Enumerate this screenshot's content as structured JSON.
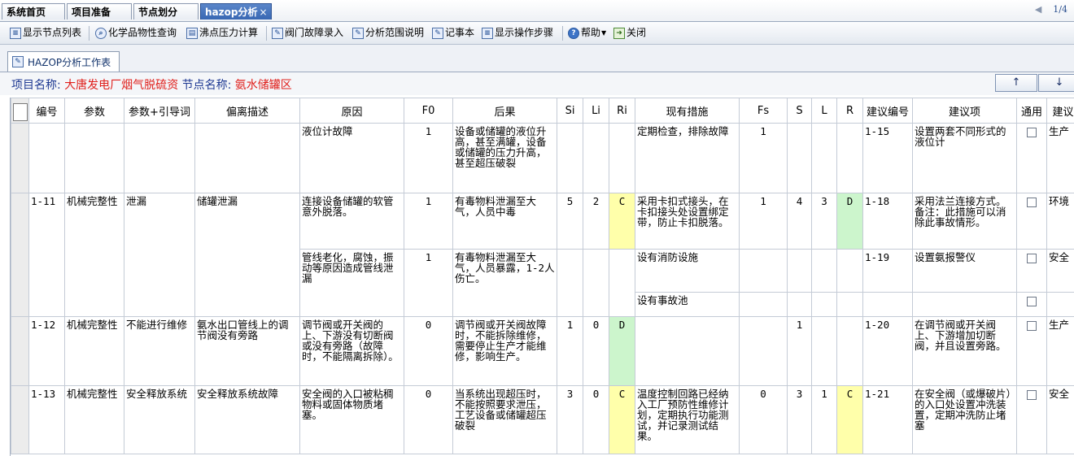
{
  "tabs": [
    {
      "label": "系统首页"
    },
    {
      "label": "项目准备"
    },
    {
      "label": "节点划分"
    },
    {
      "label": "hazop分析"
    }
  ],
  "tab_close": "×",
  "pager": {
    "arrow": "◀",
    "text": "1/4"
  },
  "toolbar": {
    "show_nodes": "显示节点列表",
    "chem_query": "化学品物性查询",
    "boil_calc": "沸点压力计算",
    "valve_fault": "阀门故障录入",
    "scope_note": "分析范围说明",
    "notepad": "记事本",
    "show_steps": "显示操作步骤",
    "help": "帮助",
    "close": "关闭"
  },
  "panel": {
    "tab_label": "HAZOP分析工作表"
  },
  "info": {
    "project_label": "项目名称:",
    "project_value": "大唐发电厂烟气脱硫资",
    "node_label": "节点名称:",
    "node_value": "氨水储罐区",
    "up": "↑",
    "down": "↓"
  },
  "colors": {
    "yellow": "#ffffaa",
    "green": "#ccf5cc",
    "red_text": "#e0201c",
    "blue_text": "#1f3a93"
  },
  "columns": [
    "编号",
    "参数",
    "参数+引导词",
    "偏离描述",
    "原因",
    "F0",
    "后果",
    "Si",
    "Li",
    "Ri",
    "现有措施",
    "Fs",
    "S",
    "L",
    "R",
    "建议编号",
    "建议项",
    "通用",
    "建议"
  ],
  "rows": [
    {
      "id": "",
      "param": "",
      "guide": "",
      "dev": "",
      "cause": "液位计故障",
      "f0": "1",
      "cons": "设备或储罐的液位升高，甚至满罐，设备或储罐的压力升高，甚至超压破裂",
      "si": "",
      "li": "",
      "ri": "",
      "meas": "定期检查，排除故障",
      "fs": "1",
      "s": "",
      "l": "",
      "r": "",
      "rid": "1-15",
      "rec": "设置两套不同形式的液位计",
      "gen": "",
      "adv": "生产"
    },
    {
      "id": "1-11",
      "param": "机械完整性",
      "guide": "泄漏",
      "dev": "储罐泄漏",
      "cause": "连接设备储罐的软管意外脱落。",
      "f0": "1",
      "cons": "有毒物料泄漏至大气，人员中毒",
      "si": "5",
      "li": "2",
      "ri": "C",
      "meas": "采用卡扣式接头，在卡扣接头处设置绑定带，防止卡扣脱落。",
      "fs": "1",
      "s": "4",
      "l": "3",
      "r": "D",
      "rid": "1-18",
      "rec": "采用法兰连接方式。备注：此措施可以消除此事故情形。",
      "gen": "",
      "adv": "环境"
    },
    {
      "cause": "管线老化，腐蚀，振动等原因造成管线泄漏",
      "f0": "1",
      "cons": "有毒物料泄漏至大气，人员暴露，1-2人伤亡。",
      "meas": "设有消防设施",
      "rid": "1-19",
      "rec": "设置氨报警仪",
      "adv": "安全"
    },
    {
      "meas": "设有事故池"
    },
    {
      "id": "1-12",
      "param": "机械完整性",
      "guide": "不能进行维修",
      "dev": "氨水出口管线上的调节阀没有旁路",
      "cause": "调节阀或开关阀的上、下游没有切断阀或没有旁路（故障时，不能隔离拆除）。",
      "f0": "0",
      "cons": "调节阀或开关阀故障时，不能拆除维修，需要停止生产才能维修，影响生产。",
      "si": "1",
      "li": "0",
      "ri": "D",
      "meas": "",
      "fs": "",
      "s": "1",
      "l": "",
      "r": "",
      "rid": "1-20",
      "rec": "在调节阀或开关阀上、下游增加切断阀，并且设置旁路。",
      "adv": "生产"
    },
    {
      "id": "1-13",
      "param": "机械完整性",
      "guide": "安全释放系统",
      "dev": "安全释放系统故障",
      "cause": "安全阀的入口被粘稠物料或固体物质堵塞。",
      "f0": "0",
      "cons": "当系统出现超压时，不能按照要求泄压，工艺设备或储罐超压破裂",
      "si": "3",
      "li": "0",
      "ri": "C",
      "meas": "温度控制回路已经纳入工厂预防性维修计划，定期执行功能测试，并记录测试结果。",
      "fs": "0",
      "s": "3",
      "l": "1",
      "r": "C",
      "rid": "1-21",
      "rec": "在安全阀（或爆破片）的入口处设置冲洗装置，定期冲洗防止堵塞",
      "adv": "安全"
    }
  ]
}
